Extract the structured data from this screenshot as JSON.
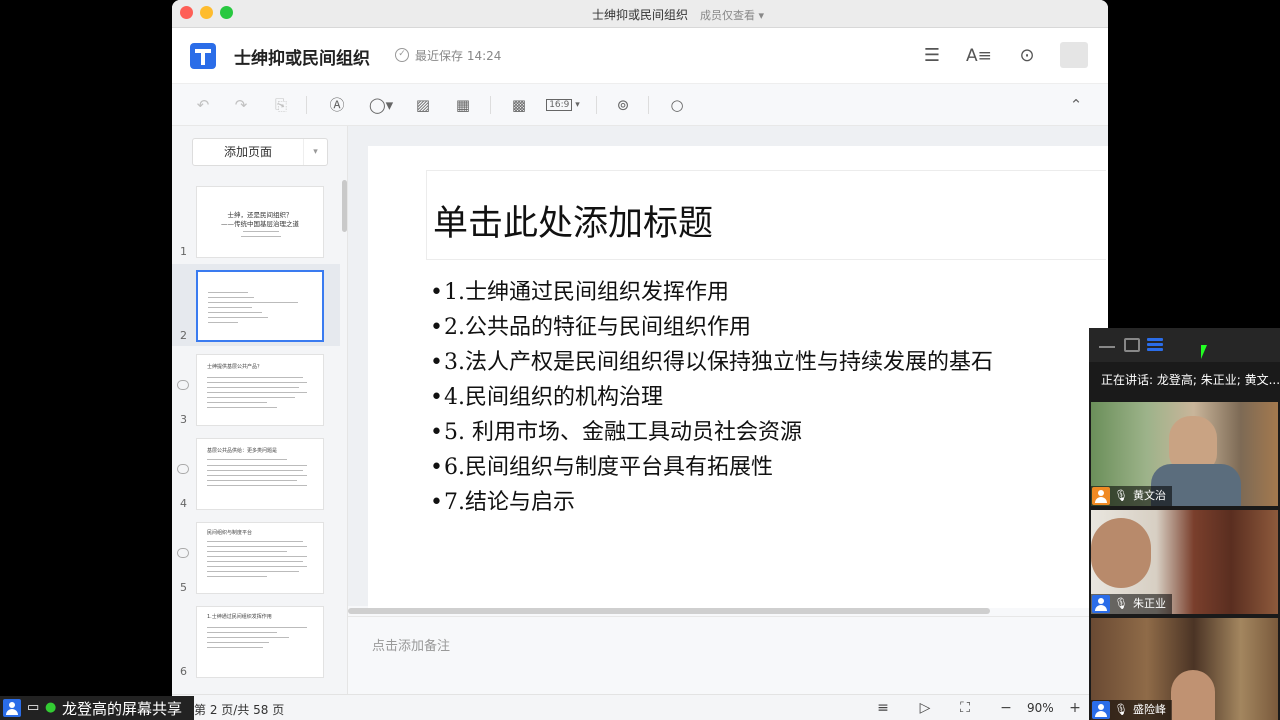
{
  "window": {
    "title": "士绅抑或民间组织",
    "mode": "成员仅查看 ▾"
  },
  "header": {
    "doc_title": "士绅抑或民间组织",
    "saved": "最近保存 14:24"
  },
  "toolbar": {
    "icons": [
      "undo-icon",
      "redo-icon",
      "format-painter-icon",
      "textbox-icon",
      "shape-icon",
      "image-icon",
      "table-icon",
      "background-icon",
      "slide-size-icon",
      "comment-icon",
      "search-icon",
      "collapse-icon"
    ],
    "slide_size": "16:9"
  },
  "sidebar": {
    "add_page": "添加页面",
    "thumbnails": [
      {
        "num": "1",
        "title": "士绅，还是民间组织？",
        "subtitle": "——传统中国基层治理之道"
      },
      {
        "num": "2",
        "title": ""
      },
      {
        "num": "3",
        "title": "士绅提供基层公共产品？"
      },
      {
        "num": "4",
        "title": "基层公共品供给：更多类问题是"
      },
      {
        "num": "5",
        "title": "民间组织与制度平台"
      },
      {
        "num": "6",
        "title": "1.士绅通过民间组织发挥作用"
      }
    ]
  },
  "slide": {
    "title": "单击此处添加标题",
    "bullets": [
      "1.士绅通过民间组织发挥作用",
      "2.公共品的特征与民间组织作用",
      "3.法人产权是民间组织得以保持独立性与持续发展的基石",
      "4.民间组织的机构治理",
      "5. 利用市场、金融工具动员社会资源",
      "6.民间组织与制度平台具有拓展性",
      "7.结论与启示"
    ]
  },
  "notes": {
    "placeholder": "点击添加备注"
  },
  "status": {
    "page_info": "第 2 页/共 58 页",
    "zoom": "90%"
  },
  "share": {
    "label": "龙登高的屏幕共享"
  },
  "meeting": {
    "speaking": "正在讲话: 龙登高; 朱正业; 黄文...",
    "participants": [
      {
        "name": "黄文治",
        "avatar_color": "#f08a24"
      },
      {
        "name": "朱正业",
        "avatar_color": "#2b6de8"
      },
      {
        "name": "盛险峰",
        "avatar_color": "#2b6de8"
      }
    ]
  },
  "colors": {
    "accent": "#2b6de8",
    "selection": "#3a7bf0"
  }
}
